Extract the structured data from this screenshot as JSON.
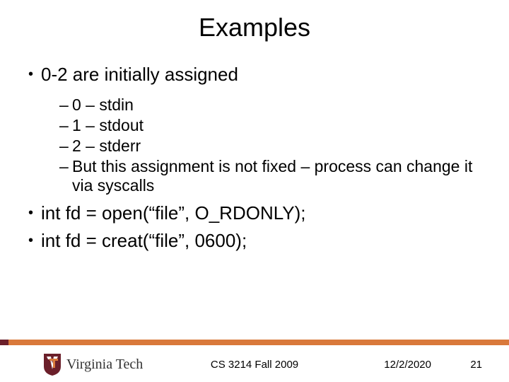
{
  "title": "Examples",
  "bullets": {
    "b1": "0-2 are initially assigned",
    "sub": {
      "s1": "0 – stdin",
      "s2": "1 – stdout",
      "s3": "2 – stderr",
      "s4": "But this assignment is not fixed – process can change it via syscalls"
    },
    "b2": "int fd = open(“file”, O_RDONLY);",
    "b3": "int fd = creat(“file”, 0600);"
  },
  "footer": {
    "course": "CS 3214 Fall 2009",
    "date": "12/2/2020",
    "page": "21"
  },
  "logo": {
    "line1": "Virginia",
    "line2": "Tech"
  }
}
